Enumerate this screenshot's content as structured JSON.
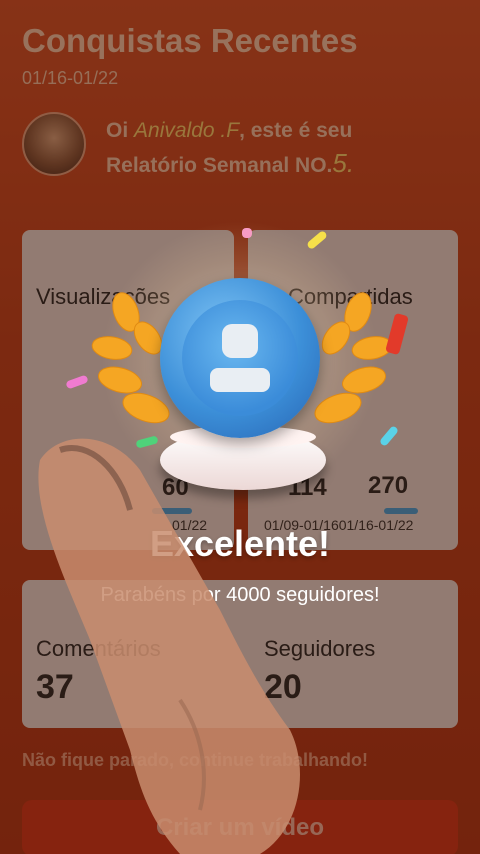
{
  "header": {
    "title": "Conquistas Recentes",
    "date_range": "01/16-01/22"
  },
  "greeting": {
    "prefix": "Oi ",
    "name": "Anivaldo .F",
    "middle": ", este é seu",
    "line2": "Relatório Semanal NO.",
    "number": "5."
  },
  "stats": {
    "views": {
      "label": "Visualizações",
      "value": "60",
      "period": "01/22"
    },
    "shares": {
      "label": "Compartidas",
      "prev_value": "114",
      "value": "270",
      "period": "01/09-01/1601/16-01/22"
    },
    "comments": {
      "label": "Comentários",
      "value": "37"
    },
    "followers": {
      "label": "Seguidores",
      "value": "20"
    }
  },
  "footer": {
    "note": "Não fique parado, continue trabalhando!",
    "cta": "Criar um vídeo"
  },
  "modal": {
    "title": "Excelente!",
    "message": "Parabéns por 4000 seguidores!"
  },
  "colors": {
    "accent": "#d3381c",
    "badge": "#3c8fd8",
    "laurel": "#f5a623"
  }
}
